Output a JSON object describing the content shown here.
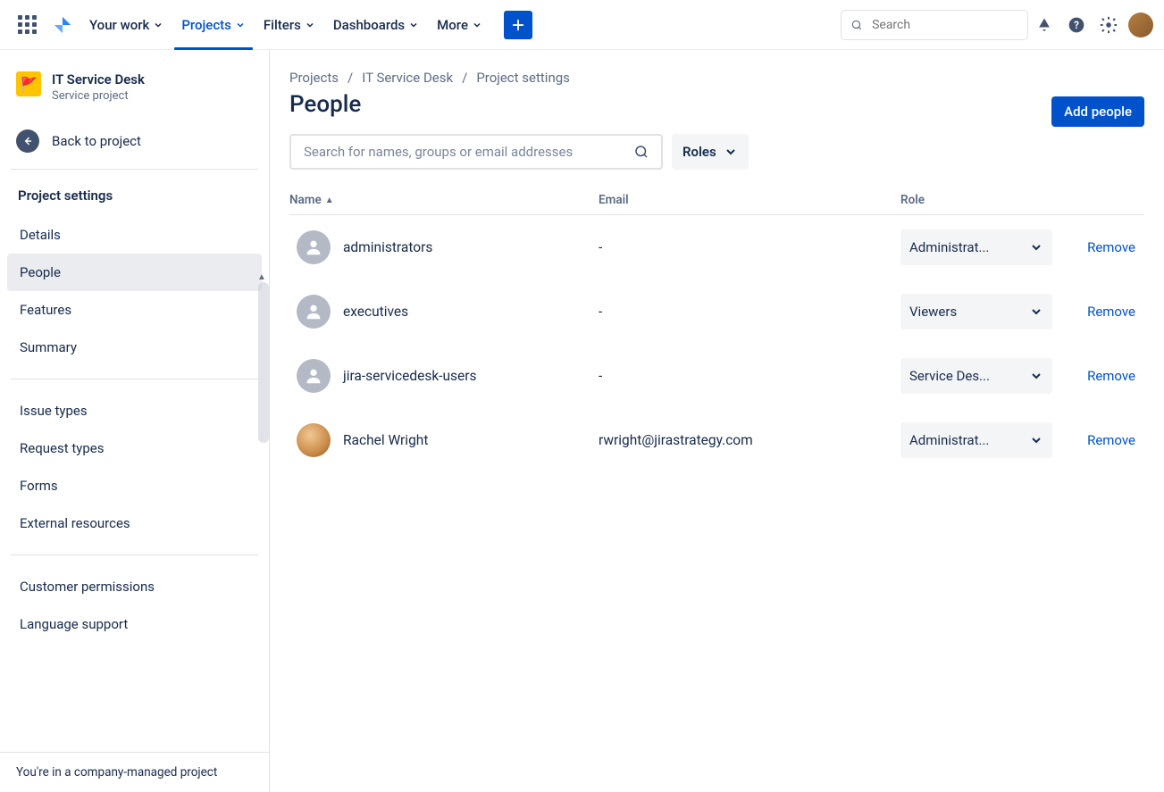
{
  "topnav": {
    "items": [
      {
        "label": "Your work"
      },
      {
        "label": "Projects",
        "active": true
      },
      {
        "label": "Filters"
      },
      {
        "label": "Dashboards"
      },
      {
        "label": "More"
      }
    ],
    "search_placeholder": "Search"
  },
  "sidebar": {
    "project_name": "IT Service Desk",
    "project_type": "Service project",
    "back_label": "Back to project",
    "heading": "Project settings",
    "groups": [
      [
        "Details",
        "People",
        "Features",
        "Summary"
      ],
      [
        "Issue types",
        "Request types",
        "Forms",
        "External resources"
      ],
      [
        "Customer permissions",
        "Language support"
      ]
    ],
    "selected": "People",
    "footer": "You're in a company-managed project"
  },
  "main": {
    "breadcrumb": [
      "Projects",
      "IT Service Desk",
      "Project settings"
    ],
    "title": "People",
    "add_button": "Add people",
    "search_placeholder": "Search for names, groups or email addresses",
    "roles_label": "Roles",
    "columns": {
      "name": "Name",
      "email": "Email",
      "role": "Role"
    },
    "remove_label": "Remove",
    "rows": [
      {
        "name": "administrators",
        "email": "-",
        "role": "Administrat...",
        "avatar": "group"
      },
      {
        "name": "executives",
        "email": "-",
        "role": "Viewers",
        "avatar": "group"
      },
      {
        "name": "jira-servicedesk-users",
        "email": "-",
        "role": "Service Des...",
        "avatar": "group"
      },
      {
        "name": "Rachel Wright",
        "email": "rwright@jirastrategy.com",
        "role": "Administrat...",
        "avatar": "person"
      }
    ]
  }
}
